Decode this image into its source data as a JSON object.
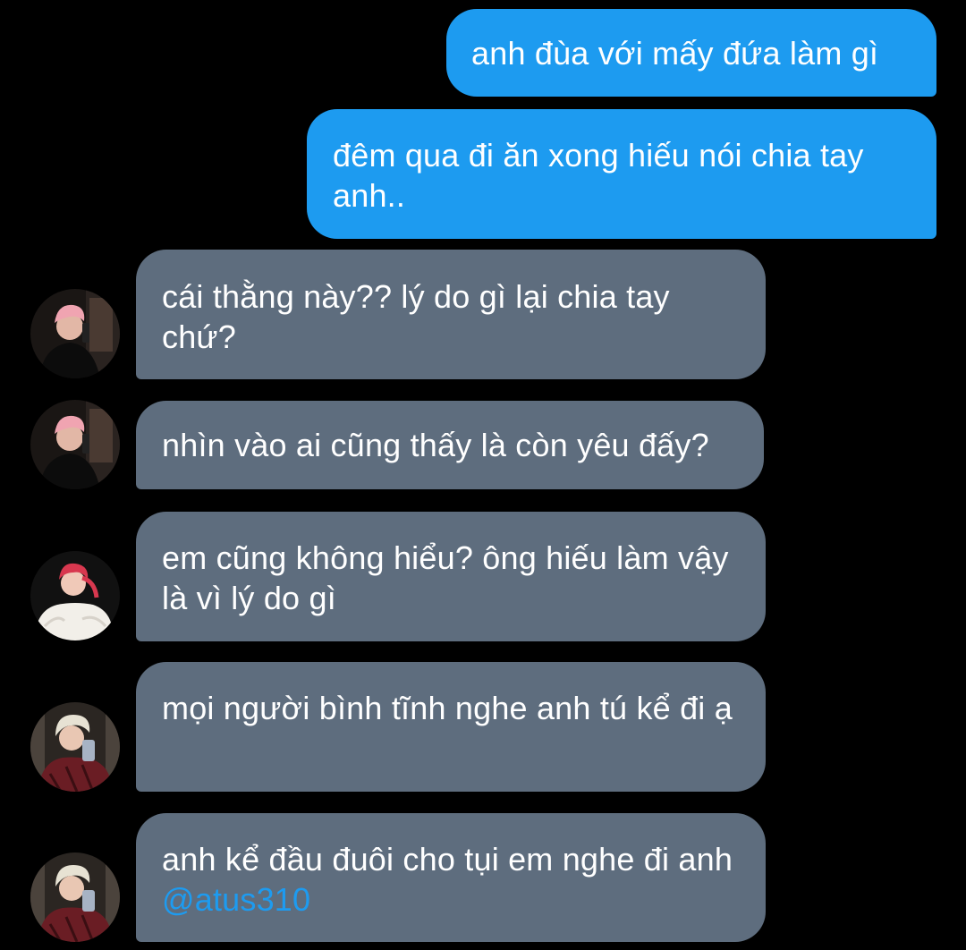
{
  "conversation": {
    "messages": [
      {
        "direction": "sent",
        "text": "anh đùa với mấy đứa làm gì"
      },
      {
        "direction": "sent",
        "text": "đêm qua đi ăn xong hiếu nói chia tay anh.."
      },
      {
        "direction": "received",
        "avatar_icon": "avatar-pink-hair-black-sweater",
        "text": "cái thằng này?? lý do gì lại chia tay chứ?"
      },
      {
        "direction": "received",
        "avatar_icon": "avatar-pink-hair-black-sweater",
        "text": "nhìn vào ai cũng thấy là còn yêu đấy?"
      },
      {
        "direction": "received",
        "avatar_icon": "avatar-red-hair-white-sweater",
        "text": "em cũng không hiểu? ông hiếu làm vậy là vì lý do gì"
      },
      {
        "direction": "received",
        "avatar_icon": "avatar-blond-hair-mirror-selfie",
        "text": "mọi người bình tĩnh nghe anh tú kể đi ạ"
      },
      {
        "direction": "received",
        "avatar_icon": "avatar-blond-hair-mirror-selfie",
        "text": "anh kể đầu đuôi cho tụi em nghe đi anh ",
        "mention": "@atus310"
      }
    ]
  },
  "colors": {
    "background": "#000000",
    "sent_bubble": "#1d9bf0",
    "received_bubble": "#5e6d7e",
    "mention_text": "#1d9bf0",
    "message_text": "#ffffff"
  }
}
